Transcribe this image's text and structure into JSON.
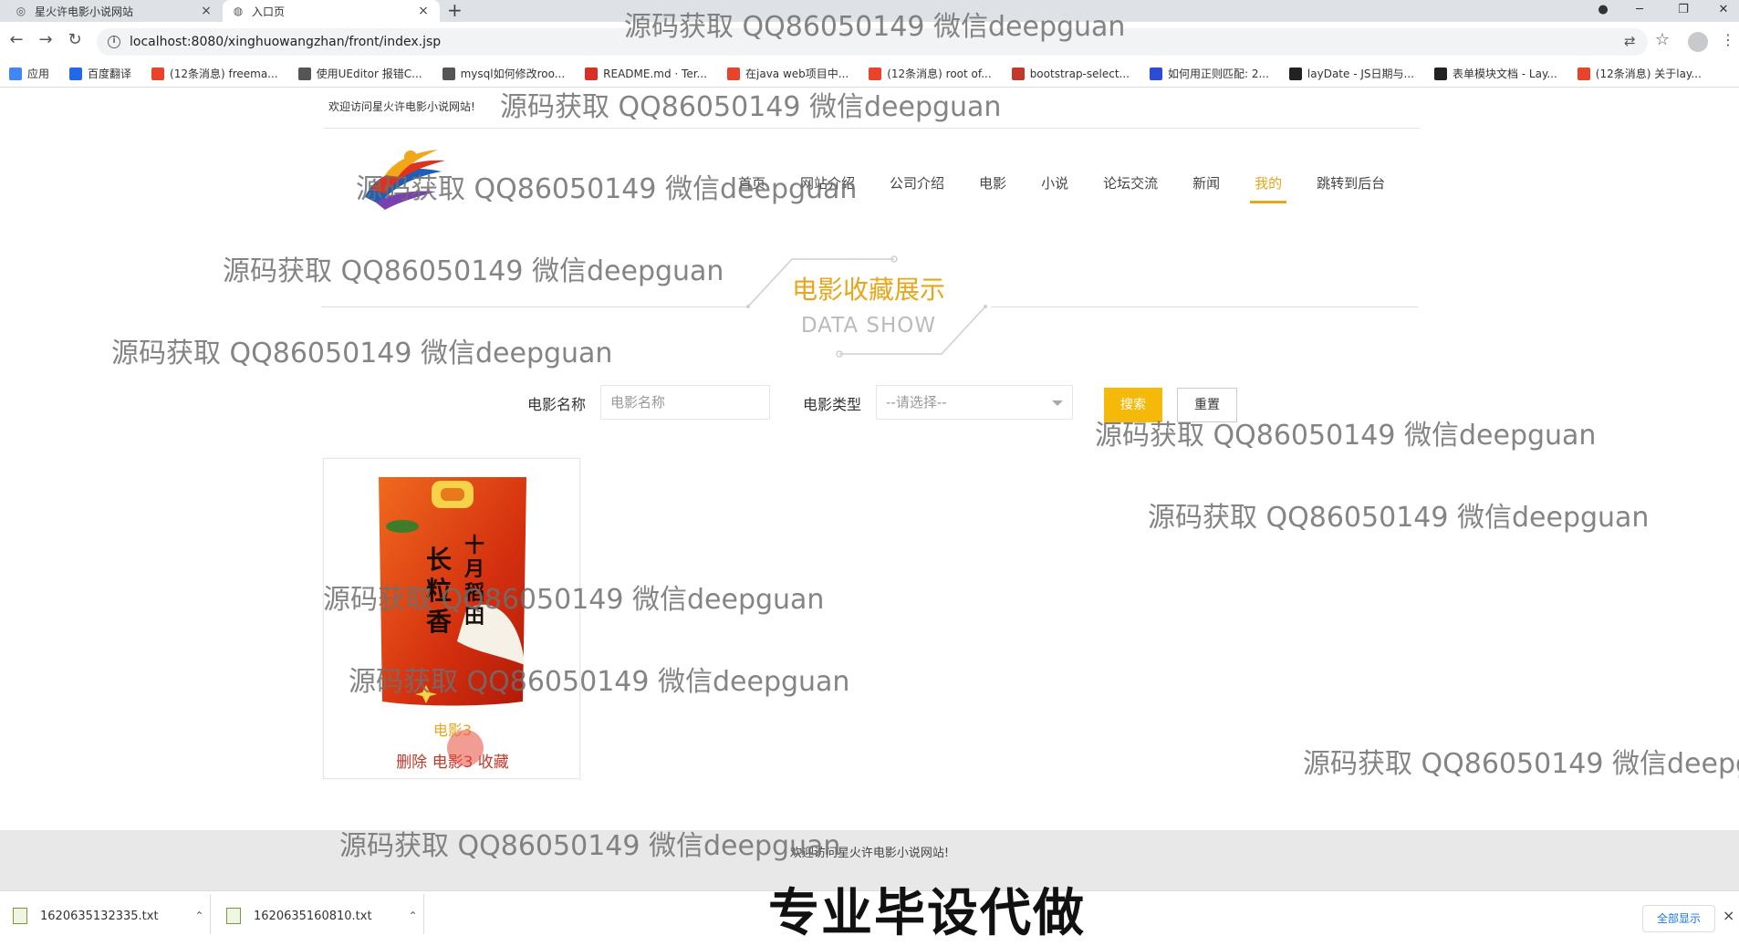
{
  "browser": {
    "tabs": [
      {
        "label": "星火许电影小说网站",
        "close": "×"
      },
      {
        "label": "入口页",
        "close": "×"
      }
    ],
    "new_tab": "+",
    "url": "localhost:8080/xinghuowangzhan/front/index.jsp",
    "bookmarks": [
      {
        "label": "应用",
        "color": "#4285f4",
        "icon": "apps-icon"
      },
      {
        "label": "百度翻译",
        "color": "#2468e8",
        "icon": "translate-icon"
      },
      {
        "label": "(12条消息) freema...",
        "color": "#e8442b",
        "icon": "csdn-icon"
      },
      {
        "label": "使用UEditor 报错C...",
        "color": "#555555",
        "icon": "ueditor-icon"
      },
      {
        "label": "mysql如何修改roo...",
        "color": "#555555",
        "icon": "mysql-icon"
      },
      {
        "label": "README.md · Ter...",
        "color": "#d93025",
        "icon": "gitee-icon"
      },
      {
        "label": "在java web项目中...",
        "color": "#e8442b",
        "icon": "csdn-icon"
      },
      {
        "label": "(12条消息) root of...",
        "color": "#e8442b",
        "icon": "csdn-icon"
      },
      {
        "label": "bootstrap-select...",
        "color": "#c0392b",
        "icon": "blog-icon"
      },
      {
        "label": "如何用正则匹配: 2...",
        "color": "#2d4bd3",
        "icon": "baidu-icon"
      },
      {
        "label": "layDate - JS日期与...",
        "color": "#222222",
        "icon": "layui-icon"
      },
      {
        "label": "表单模块文档 - Lay...",
        "color": "#222222",
        "icon": "layui-icon"
      },
      {
        "label": "(12条消息) 关于lay...",
        "color": "#e8442b",
        "icon": "csdn-icon"
      }
    ]
  },
  "header": {
    "welcome": "欢迎访问星火许电影小说网站!",
    "nav": [
      {
        "label": "首页",
        "active": false
      },
      {
        "label": "网站介绍",
        "active": false
      },
      {
        "label": "公司介绍",
        "active": false
      },
      {
        "label": "电影",
        "active": false
      },
      {
        "label": "小说",
        "active": false
      },
      {
        "label": "论坛交流",
        "active": false
      },
      {
        "label": "新闻",
        "active": false
      },
      {
        "label": "我的",
        "active": true
      },
      {
        "label": "跳转到后台",
        "active": false
      }
    ],
    "accent_color": "#e8a61a"
  },
  "section": {
    "title": "电影收藏展示",
    "subtitle": "DATA SHOW"
  },
  "search": {
    "name_label": "电影名称",
    "name_placeholder": "电影名称",
    "type_label": "电影类型",
    "type_selected": "--请选择--",
    "search_button": "搜索",
    "reset_button": "重置"
  },
  "cards": [
    {
      "title": "电影3",
      "delete_label": "删除 电影3 收藏"
    }
  ],
  "footer": {
    "text": "欢迎访问星火许电影小说网站!"
  },
  "downloads": {
    "items": [
      {
        "filename": "1620635132335.txt"
      },
      {
        "filename": "1620635160810.txt"
      }
    ],
    "show_all": "全部显示",
    "close": "×"
  },
  "watermarks": {
    "line": "源码获取 QQ86050149 微信deepguan",
    "line_cut": "源码获取 QQ86050149 微信deepg",
    "banner": "专业毕设代做"
  }
}
